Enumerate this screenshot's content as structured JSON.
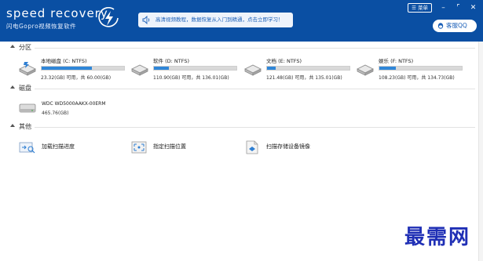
{
  "header": {
    "app_name": "speed recovery",
    "app_subtitle": "闪电Gopro视频恢复软件",
    "notice_text": "高清视频教程，数据恢复从入门到精通，点击立即学习！",
    "menu_label": "菜单",
    "qq_label": "客服QQ",
    "icons": [
      "lightning-logo",
      "speaker-icon",
      "minimize-icon",
      "maximize-icon",
      "close-icon",
      "qq-icon"
    ]
  },
  "sections": {
    "partitions_label": "分区",
    "disks_label": "磁盘",
    "other_label": "其他"
  },
  "partitions": [
    {
      "name": "本地磁盘 (C: NTFS)",
      "info": "23.32(GB) 可用，共 60.00(GB)",
      "used_fraction": 0.61
    },
    {
      "name": "软件 (D: NTFS)",
      "info": "110.90(GB) 可用，共 136.01(GB)",
      "used_fraction": 0.18
    },
    {
      "name": "文档 (E: NTFS)",
      "info": "121.48(GB) 可用，共 135.01(GB)",
      "used_fraction": 0.1
    },
    {
      "name": "娱乐 (F: NTFS)",
      "info": "108.23(GB) 可用，共 134.73(GB)",
      "used_fraction": 0.2
    }
  ],
  "disk": {
    "name": "WDC WD5000AAKX-00ERM",
    "size": "465.76(GB)"
  },
  "tools": [
    {
      "label": "加载扫描进度",
      "icon": "load-progress-icon"
    },
    {
      "label": "指定扫描位置",
      "icon": "scan-location-icon"
    },
    {
      "label": "扫描存储设备镜像",
      "icon": "disk-image-icon"
    }
  ],
  "watermark": "最需网",
  "colors": {
    "header": "#0a4fa3",
    "bar_fill": "#2f86d8",
    "watermark": "#1f2fb5"
  }
}
